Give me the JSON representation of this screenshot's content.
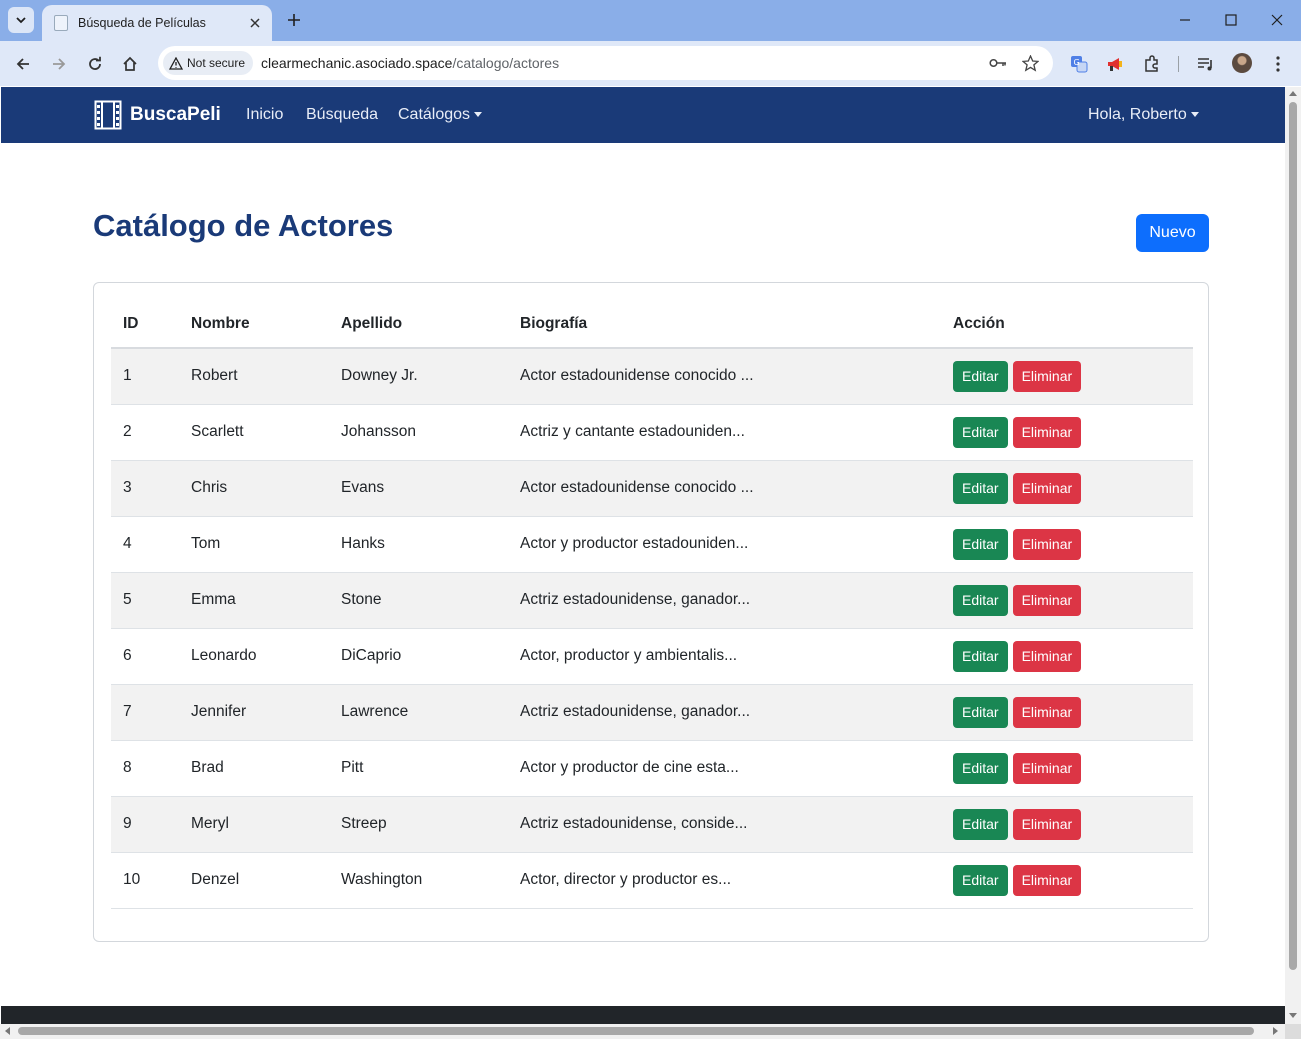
{
  "browser": {
    "tab_title": "Búsqueda de Películas",
    "security_label": "Not secure",
    "url_host": "clearmechanic.asociado.space",
    "url_path": "/catalogo/actores",
    "titlebar_color": "#8aaee8"
  },
  "navbar": {
    "brand": "BuscaPeli",
    "links": [
      "Inicio",
      "Búsqueda",
      "Catálogos"
    ],
    "user": "Hola, Roberto",
    "background": "#1a3a78"
  },
  "page": {
    "title": "Catálogo de Actores",
    "new_button": "Nuevo"
  },
  "table": {
    "headers": [
      "ID",
      "Nombre",
      "Apellido",
      "Biografía",
      "Acción"
    ],
    "edit_label": "Editar",
    "delete_label": "Eliminar",
    "rows": [
      {
        "id": "1",
        "nombre": "Robert",
        "apellido": "Downey Jr.",
        "bio": "Actor estadounidense conocido ..."
      },
      {
        "id": "2",
        "nombre": "Scarlett",
        "apellido": "Johansson",
        "bio": "Actriz y cantante estadouniden..."
      },
      {
        "id": "3",
        "nombre": "Chris",
        "apellido": "Evans",
        "bio": "Actor estadounidense conocido ..."
      },
      {
        "id": "4",
        "nombre": "Tom",
        "apellido": "Hanks",
        "bio": "Actor y productor estadouniden..."
      },
      {
        "id": "5",
        "nombre": "Emma",
        "apellido": "Stone",
        "bio": "Actriz estadounidense, ganador..."
      },
      {
        "id": "6",
        "nombre": "Leonardo",
        "apellido": "DiCaprio",
        "bio": "Actor, productor y ambientalis..."
      },
      {
        "id": "7",
        "nombre": "Jennifer",
        "apellido": "Lawrence",
        "bio": "Actriz estadounidense, ganador..."
      },
      {
        "id": "8",
        "nombre": "Brad",
        "apellido": "Pitt",
        "bio": "Actor y productor de cine esta..."
      },
      {
        "id": "9",
        "nombre": "Meryl",
        "apellido": "Streep",
        "bio": "Actriz estadounidense, conside..."
      },
      {
        "id": "10",
        "nombre": "Denzel",
        "apellido": "Washington",
        "bio": "Actor, director y productor es..."
      }
    ]
  },
  "colors": {
    "primary": "#0d6efd",
    "success": "#198754",
    "danger": "#dc3545",
    "title": "#1a3a78"
  },
  "icons": [
    "tab-list-icon",
    "page-icon",
    "close-icon",
    "plus-icon",
    "minimize-icon",
    "maximize-icon",
    "back-icon",
    "forward-icon",
    "reload-icon",
    "home-icon",
    "warning-icon",
    "key-icon",
    "star-icon",
    "translate-icon",
    "megaphone-icon",
    "puzzle-icon",
    "media-icon",
    "kebab-menu-icon",
    "film-icon"
  ]
}
